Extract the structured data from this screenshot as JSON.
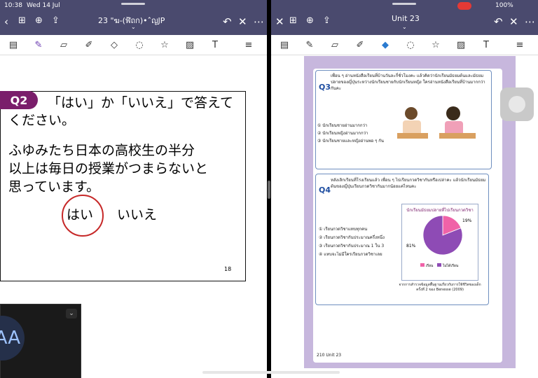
{
  "status": {
    "time": "10:38",
    "date": "Wed 14 Jul",
    "battery": "100%"
  },
  "left": {
    "title": "23 \"ฆ-(ฬ้ถก)•ˆ̂ญJP",
    "slide": {
      "badge": "Q2",
      "question_line1": "「はい」か「いいえ」で答えて",
      "question_line2": "ください。",
      "body_line1": "ふゆみたち日本の高校生の半分",
      "body_line2": "以上は毎日の授業がつまらないと",
      "body_line3": "思っています。",
      "answer_yes": "はい",
      "answer_no": "いいえ",
      "page_number": "18"
    },
    "video_tile": {
      "initials": "AA"
    }
  },
  "right": {
    "title": "Unit 23",
    "page": {
      "q3_label": "Q3",
      "q3_text": "เพื่อน ๆ อ่านหนังสือเรียนที่บ้านวันละกี่ชั่วโมงคะ แล้วคิดว่านักเรียนมัธยมต้นและมัธยมปลายของญี่ปุ่นระหว่างนักเรียนชายกับนักเรียนหญิง ใครอ่านหนังสือเรียนที่บ้านมากกว่ากันคะ",
      "q3_options": [
        "① นักเรียนชายอ่านมากกว่า",
        "② นักเรียนหญิงอ่านมากกว่า",
        "③ นักเรียนชายและหญิงอ่านพอ ๆ กัน"
      ],
      "q4_label": "Q4",
      "q4_text": "หลังเลิกเรียนที่โรงเรียนแล้ว เพื่อน ๆ ไปเรียนกวดวิชากันหรือเปล่าคะ แล้วนักเรียนมัธยมต้นของญี่ปุ่นเรียนกวดวิชากันมากน้อยแค่ไหนคะ",
      "q4_options": [
        "① เรียนกวดวิชาแทบทุกคน",
        "② เรียนกวดวิชากันประมาณครึ่งหนึ่ง",
        "③ เรียนกวดวิชากันประมาณ 1 ใน 3",
        "④ แทบจะไม่มีใครเรียนกวดวิชาเลย"
      ],
      "chart_title": "นักเรียนมัธยมปลายที่ไปเรียนกวดวิชา",
      "chart_source": "จากการสำรวจข้อมูลพื้นฐานเกี่ยวกับการใช้ชีวิตของเด็ก ครั้งที่ 2 ของ Benesse (2009)",
      "footer": "210  Unit 23"
    }
  },
  "chart_data": {
    "type": "pie",
    "title": "นักเรียนมัธยมปลายที่ไปเรียนกวดวิชา",
    "slices": [
      {
        "name": "เรียน",
        "value": 19,
        "color": "#f062a8"
      },
      {
        "name": "ไม่ได้เรียน",
        "value": 81,
        "color": "#8e4bb5"
      }
    ],
    "labels": [
      "19%",
      "81%"
    ],
    "legend": [
      "เรียน",
      "ไม่ได้เรียน"
    ]
  }
}
